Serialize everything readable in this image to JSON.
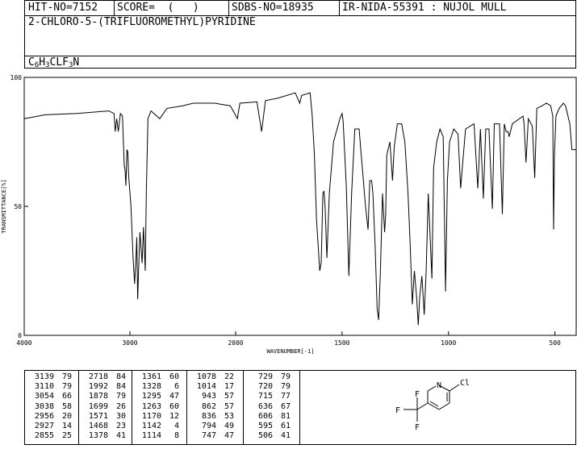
{
  "header": {
    "hit_no": "HIT-NO=7152",
    "score": "SCORE=  (   )",
    "sdbs_no": "SDBS-NO=18935",
    "ir_code": "IR-NIDA-55391 : NUJOL MULL"
  },
  "compound": {
    "name": "2-CHLORO-5-(TRIFLUOROMETHYL)PYRIDINE",
    "formula_parts": [
      "C",
      "6",
      "H",
      "3",
      "CLF",
      "3",
      "N"
    ]
  },
  "chart_data": {
    "type": "line",
    "xlabel": "WAVENUMBER[-1]",
    "ylabel": "TRANSMITTANCE[%]",
    "xlim": [
      4000,
      400
    ],
    "ylim": [
      0,
      100
    ],
    "x_ticks": [
      4000,
      3000,
      2000,
      1500,
      1000,
      500
    ],
    "y_ticks": [
      0,
      50,
      100
    ],
    "grid": false,
    "legend": "none",
    "series": [
      {
        "color": "#000000",
        "points": [
          [
            4000,
            84
          ],
          [
            3800,
            85.5
          ],
          [
            3500,
            86
          ],
          [
            3200,
            87
          ],
          [
            3150,
            86
          ],
          [
            3139,
            79
          ],
          [
            3125,
            84
          ],
          [
            3110,
            79
          ],
          [
            3090,
            86
          ],
          [
            3070,
            85
          ],
          [
            3054,
            66
          ],
          [
            3046,
            64
          ],
          [
            3038,
            58
          ],
          [
            3028,
            72
          ],
          [
            3020,
            71
          ],
          [
            3012,
            62
          ],
          [
            2990,
            50
          ],
          [
            2970,
            30
          ],
          [
            2956,
            20
          ],
          [
            2945,
            28
          ],
          [
            2935,
            38
          ],
          [
            2927,
            14
          ],
          [
            2918,
            25
          ],
          [
            2905,
            40
          ],
          [
            2885,
            28
          ],
          [
            2872,
            42
          ],
          [
            2855,
            25
          ],
          [
            2845,
            55
          ],
          [
            2830,
            84
          ],
          [
            2800,
            87
          ],
          [
            2718,
            84
          ],
          [
            2650,
            88
          ],
          [
            2500,
            89
          ],
          [
            2400,
            90
          ],
          [
            2200,
            90
          ],
          [
            2050,
            89
          ],
          [
            2010,
            86
          ],
          [
            1992,
            84
          ],
          [
            1980,
            90
          ],
          [
            1900,
            90.5
          ],
          [
            1878,
            79
          ],
          [
            1860,
            91
          ],
          [
            1800,
            92
          ],
          [
            1720,
            94
          ],
          [
            1699,
            90
          ],
          [
            1690,
            93
          ],
          [
            1650,
            94
          ],
          [
            1640,
            85
          ],
          [
            1630,
            70
          ],
          [
            1620,
            45
          ],
          [
            1605,
            25
          ],
          [
            1598,
            28
          ],
          [
            1590,
            55
          ],
          [
            1585,
            56
          ],
          [
            1580,
            50
          ],
          [
            1571,
            30
          ],
          [
            1560,
            55
          ],
          [
            1540,
            75
          ],
          [
            1510,
            84
          ],
          [
            1500,
            86
          ],
          [
            1495,
            83
          ],
          [
            1480,
            58
          ],
          [
            1468,
            23
          ],
          [
            1455,
            55
          ],
          [
            1440,
            80
          ],
          [
            1420,
            80
          ],
          [
            1410,
            70
          ],
          [
            1400,
            60
          ],
          [
            1390,
            50
          ],
          [
            1378,
            41
          ],
          [
            1370,
            60
          ],
          [
            1361,
            60
          ],
          [
            1355,
            55
          ],
          [
            1345,
            35
          ],
          [
            1335,
            10
          ],
          [
            1328,
            6
          ],
          [
            1320,
            25
          ],
          [
            1310,
            55
          ],
          [
            1300,
            40
          ],
          [
            1295,
            47
          ],
          [
            1290,
            70
          ],
          [
            1275,
            75
          ],
          [
            1263,
            60
          ],
          [
            1255,
            73
          ],
          [
            1240,
            82
          ],
          [
            1220,
            82
          ],
          [
            1205,
            75
          ],
          [
            1190,
            55
          ],
          [
            1180,
            35
          ],
          [
            1170,
            12
          ],
          [
            1160,
            25
          ],
          [
            1150,
            15
          ],
          [
            1142,
            4
          ],
          [
            1135,
            15
          ],
          [
            1125,
            23
          ],
          [
            1114,
            8
          ],
          [
            1105,
            25
          ],
          [
            1095,
            55
          ],
          [
            1078,
            22
          ],
          [
            1070,
            65
          ],
          [
            1055,
            75
          ],
          [
            1040,
            80
          ],
          [
            1025,
            77
          ],
          [
            1014,
            17
          ],
          [
            1005,
            60
          ],
          [
            995,
            75
          ],
          [
            975,
            80
          ],
          [
            955,
            78
          ],
          [
            943,
            57
          ],
          [
            935,
            65
          ],
          [
            920,
            80
          ],
          [
            880,
            82
          ],
          [
            862,
            57
          ],
          [
            850,
            80
          ],
          [
            836,
            53
          ],
          [
            825,
            80
          ],
          [
            810,
            80
          ],
          [
            794,
            49
          ],
          [
            785,
            82
          ],
          [
            760,
            82
          ],
          [
            747,
            47
          ],
          [
            738,
            82
          ],
          [
            729,
            79
          ],
          [
            720,
            79
          ],
          [
            715,
            77
          ],
          [
            700,
            82
          ],
          [
            650,
            85
          ],
          [
            645,
            82
          ],
          [
            636,
            67
          ],
          [
            625,
            84
          ],
          [
            606,
            81
          ],
          [
            595,
            61
          ],
          [
            585,
            88
          ],
          [
            560,
            89
          ],
          [
            540,
            90
          ],
          [
            520,
            89
          ],
          [
            510,
            85
          ],
          [
            506,
            41
          ],
          [
            502,
            70
          ],
          [
            495,
            85
          ],
          [
            480,
            88
          ],
          [
            460,
            90
          ],
          [
            450,
            89
          ],
          [
            430,
            82
          ],
          [
            420,
            72
          ],
          [
            400,
            72
          ]
        ]
      }
    ]
  },
  "peaks": {
    "columns": [
      [
        [
          "3139",
          "79"
        ],
        [
          "3110",
          "79"
        ],
        [
          "3054",
          "66"
        ],
        [
          "3038",
          "58"
        ],
        [
          "2956",
          "20"
        ],
        [
          "2927",
          "14"
        ],
        [
          "2855",
          "25"
        ]
      ],
      [
        [
          "2718",
          "84"
        ],
        [
          "1992",
          "84"
        ],
        [
          "1878",
          "79"
        ],
        [
          "1699",
          "26"
        ],
        [
          "1571",
          "30"
        ],
        [
          "1468",
          "23"
        ],
        [
          "1378",
          "41"
        ]
      ],
      [
        [
          "1361",
          "60"
        ],
        [
          "1328",
          "6"
        ],
        [
          "1295",
          "47"
        ],
        [
          "1263",
          "60"
        ],
        [
          "1170",
          "12"
        ],
        [
          "1142",
          "4"
        ],
        [
          "1114",
          "8"
        ]
      ],
      [
        [
          "1078",
          "22"
        ],
        [
          "1014",
          "17"
        ],
        [
          "943",
          "57"
        ],
        [
          "862",
          "57"
        ],
        [
          "836",
          "53"
        ],
        [
          "794",
          "49"
        ],
        [
          "747",
          "47"
        ]
      ],
      [
        [
          "729",
          "79"
        ],
        [
          "720",
          "79"
        ],
        [
          "715",
          "77"
        ],
        [
          "636",
          "67"
        ],
        [
          "606",
          "81"
        ],
        [
          "595",
          "61"
        ],
        [
          "506",
          "41"
        ]
      ]
    ]
  },
  "structure": {
    "labels": {
      "n": "N",
      "cl": "Cl",
      "f_top": "F",
      "f_left": "F",
      "f_bottom": "F"
    }
  }
}
